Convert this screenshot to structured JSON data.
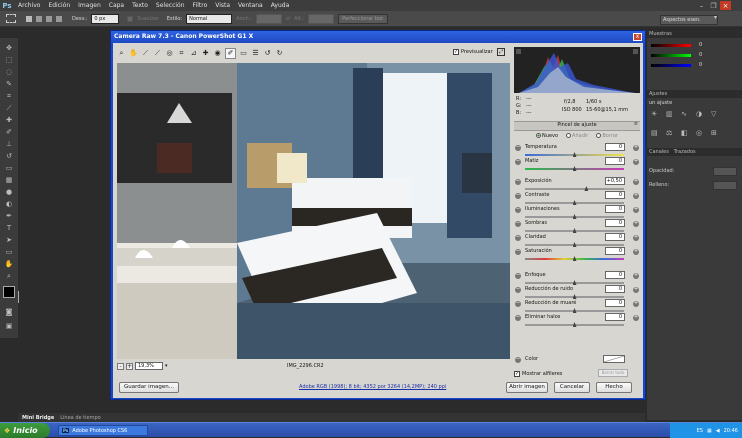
{
  "menubar": {
    "logo": "Ps",
    "items": [
      "Archivo",
      "Edición",
      "Imagen",
      "Capa",
      "Texto",
      "Selección",
      "Filtro",
      "Vista",
      "Ventana",
      "Ayuda"
    ]
  },
  "options_bar": {
    "desv_label": "Desv.:",
    "desv_value": "0 px",
    "suavizar_label": "Suavizar",
    "estilo_label": "Estilo:",
    "estilo_value": "Normal",
    "anch_label": "Anch.:",
    "alt_label": "Alt.:",
    "refine_button": "Perfeccionar bor.",
    "workspace": "Aspectos esen."
  },
  "dock": {
    "muestras": "Muestras",
    "ajustes": "Ajustes",
    "add_adjust": "un ajuste",
    "canales": "Canales",
    "trazados": "Trazados",
    "opacidad": "Opacidad:",
    "relleno": "Relleno:",
    "swatch_values": [
      "0",
      "0",
      "0"
    ]
  },
  "bridge_tabs": [
    "Mini Bridge",
    "Línea de tiempo"
  ],
  "taskbar": {
    "start": "Inicio",
    "task_item": "Adobe Photoshop CS6",
    "lang": "ES",
    "time": "20:46"
  },
  "dialog": {
    "title": "Camera Raw 7.3  -  Canon PowerShot G1 X",
    "close": "x",
    "preview_label": "Previsualizar",
    "zoom_value": "19,3%",
    "filename": "IMG_2296.CR2",
    "exif": {
      "r_label": "R:",
      "g_label": "G:",
      "b_label": "B:",
      "dash": "---",
      "aperture": "f/2,8",
      "shutter": "1/60 s",
      "iso": "ISO 800",
      "lens": "15-60@15,1 mm"
    },
    "panel_title": "Pincel de ajuste",
    "modes": {
      "new": "Nuevo",
      "add": "Añadir",
      "erase": "Borrar"
    },
    "sliders": [
      {
        "label": "Temperatura",
        "value": "0",
        "pos": 0.5
      },
      {
        "label": "Matiz",
        "value": "0",
        "pos": 0.5
      },
      {
        "label": "Exposición",
        "value": "+0,50",
        "pos": 0.62
      },
      {
        "label": "Contraste",
        "value": "0",
        "pos": 0.5
      },
      {
        "label": "Iluminaciones",
        "value": "0",
        "pos": 0.5
      },
      {
        "label": "Sombras",
        "value": "0",
        "pos": 0.5
      },
      {
        "label": "Claridad",
        "value": "0",
        "pos": 0.5
      },
      {
        "label": "Saturación",
        "value": "0",
        "pos": 0.5
      },
      {
        "label": "Enfoque",
        "value": "0",
        "pos": 0.5
      },
      {
        "label": "Reducción de ruido",
        "value": "0",
        "pos": 0.5
      },
      {
        "label": "Reducción de muaré",
        "value": "0",
        "pos": 0.5
      },
      {
        "label": "Eliminar halos",
        "value": "0",
        "pos": 0.5
      }
    ],
    "color_label": "Color",
    "show_pins_label": "Mostrar alfileres",
    "clear_all": "Borrar todo",
    "save_button": "Guardar imagen...",
    "workflow_link": "Adobe RGB (1998); 8 bit; 4352 por 3264 (14,2MP); 240 ppi",
    "open_button": "Abrir imagen",
    "cancel_button": "Cancelar",
    "done_button": "Hecho"
  }
}
